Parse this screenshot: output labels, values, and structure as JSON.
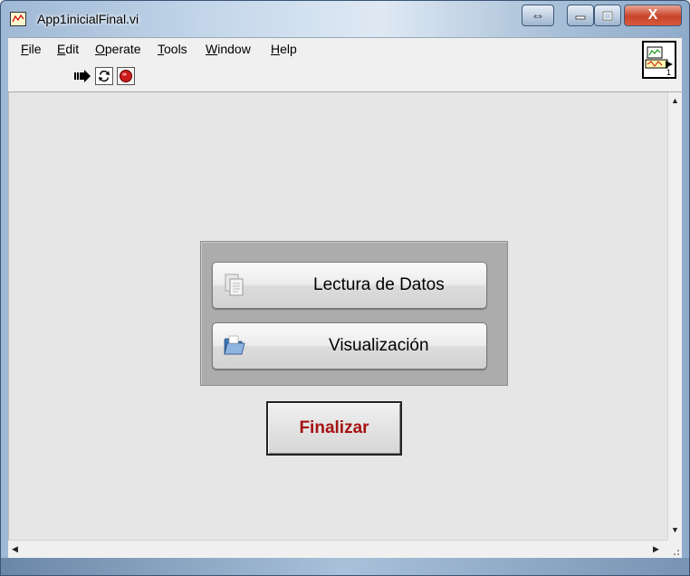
{
  "window": {
    "title": "App1inicialFinal.vi",
    "close_glyph": "X"
  },
  "menu": {
    "items": [
      {
        "key": "F",
        "rest": "ile"
      },
      {
        "key": "E",
        "rest": "dit"
      },
      {
        "key": "O",
        "rest": "perate"
      },
      {
        "key": "T",
        "rest": "ools"
      },
      {
        "key": "W",
        "rest": "indow"
      },
      {
        "key": "H",
        "rest": "elp"
      }
    ]
  },
  "toolbar": {
    "icons": [
      "run-arrow-icon",
      "run-continuously-icon",
      "abort-stop-icon"
    ],
    "vi_icon_number": "1"
  },
  "panel": {
    "lectura_label": "Lectura de Datos",
    "visualizacion_label": "Visualización",
    "finalizar_label": "Finalizar"
  },
  "colors": {
    "accent_red": "#a51212",
    "panel_bg": "#e6e6e6",
    "group_bg": "#acacac"
  }
}
